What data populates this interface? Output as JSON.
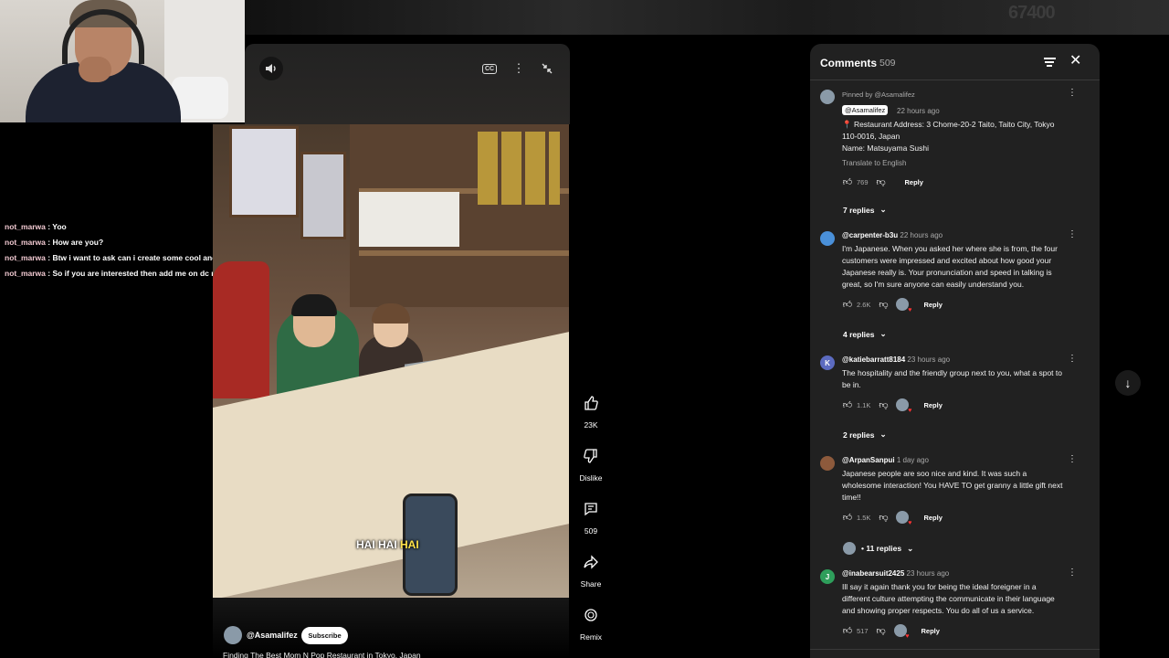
{
  "overlay": {
    "counter": "67400"
  },
  "chat": [
    {
      "user": "not_marwa",
      "message": "Yoo"
    },
    {
      "user": "not_marwa",
      "message": "How are you?"
    },
    {
      "user": "not_marwa",
      "message": "Btw i want to ask can i create some cool and attractive arts for your channel please?"
    },
    {
      "user": "not_marwa",
      "message": "So if you are interested then add me on dc not_marwa"
    }
  ],
  "player": {
    "volume_icon": "volume-icon",
    "cc_icon": "cc-icon",
    "cc_label": "CC",
    "more_icon": "more-vertical-icon",
    "minimize_icon": "minimize-icon",
    "caption_normal": "HAI HAI ",
    "caption_highlight": "HAI",
    "channel": "@Asamalifez",
    "subscribe": "Subscribe",
    "title": "Finding The Best Mom N Pop Restaurant in Tokyo, Japan"
  },
  "actions": {
    "like": {
      "icon": "thumbs-up-icon",
      "label": "23K"
    },
    "dislike": {
      "icon": "thumbs-down-icon",
      "label": "Dislike"
    },
    "comments": {
      "icon": "comment-icon",
      "label": "509"
    },
    "share": {
      "icon": "share-icon",
      "label": "Share"
    },
    "remix": {
      "icon": "remix-icon",
      "label": "Remix"
    }
  },
  "comments_panel": {
    "title": "Comments",
    "count": "509",
    "sort_icon": "sort-icon",
    "close_icon": "close-icon",
    "items": [
      {
        "pinned_by": "Pinned by @Asamalifez",
        "author": "@Asamalifez",
        "time": "22 hours ago",
        "lines": [
          "📍 Restaurant Address: 3 Chome-20-2 Taito, Taito City, Tokyo",
          "110-0016, Japan",
          "Name: Matsuyama Sushi"
        ],
        "translate": "Translate to English",
        "likes": "769",
        "reply": "Reply",
        "replies": "7 replies",
        "avatar_color": "#8a9aa8",
        "avatar_letter": ""
      },
      {
        "author": "@carpenter-b3u",
        "time": "22 hours ago",
        "lines": [
          "I'm Japanese. When you asked her where she is from, the four",
          "customers were impressed and excited about how good your",
          "Japanese really is. Your pronunciation and speed in talking is",
          "great, so I'm sure anyone can easily understand you."
        ],
        "likes": "2.6K",
        "reply": "Reply",
        "replies": "4 replies",
        "avatar_color": "#4a90d9",
        "avatar_letter": ""
      },
      {
        "author": "@katiebarratt8184",
        "time": "23 hours ago",
        "lines": [
          "The hospitality and the friendly group next to you, what a spot to",
          "be in."
        ],
        "likes": "1.1K",
        "reply": "Reply",
        "replies": "2 replies",
        "avatar_color": "#5c6bc0",
        "avatar_letter": "K"
      },
      {
        "author": "@ArpanSanpui",
        "time": "1 day ago",
        "lines": [
          "Japanese people are soo nice and kind. It was such a",
          "wholesome interaction! You HAVE TO get granny a little gift next",
          "time!!"
        ],
        "likes": "1.5K",
        "reply": "Reply",
        "replies": "• 11 replies",
        "avatar_color": "#8d5a3c",
        "avatar_letter": ""
      },
      {
        "author": "@inabearsuit2425",
        "time": "23 hours ago",
        "lines": [
          "Ill say it again thank you for being the ideal foreigner in a",
          "different culture attempting the communicate in their language",
          "and showing proper respects. You do all of us a service."
        ],
        "likes": "517",
        "reply": "Reply",
        "avatar_color": "#2e9e5b",
        "avatar_letter": "J"
      }
    ]
  },
  "scroll_icon": "arrow-down-icon"
}
